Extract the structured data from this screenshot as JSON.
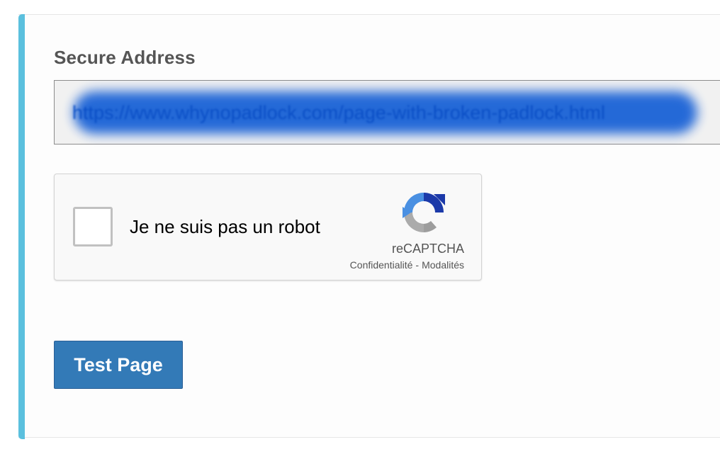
{
  "form": {
    "label": "Secure Address",
    "url_value": "https://www.whynopadlock.com/page-with-broken-padlock.html",
    "submit_label": "Test Page"
  },
  "captcha": {
    "label": "Je ne suis pas un robot",
    "brand": "reCAPTCHA",
    "privacy_link": "Confidentialité",
    "separator": "-",
    "terms_link": "Modalités",
    "logo_icon": "recaptcha-logo-icon",
    "checked": false
  },
  "colors": {
    "accent": "#5bc0de",
    "button": "#337ab7",
    "url_highlight": "#1a62d6"
  }
}
